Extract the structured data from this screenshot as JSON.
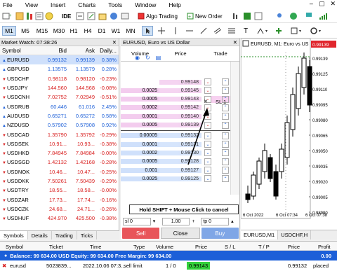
{
  "menu": [
    "File",
    "View",
    "Insert",
    "Charts",
    "Tools",
    "Window",
    "Help"
  ],
  "window_controls": [
    "–",
    "▢",
    "✕"
  ],
  "toolbar": {
    "ide_label": "IDE",
    "algo_label": "Algo Trading",
    "new_order_label": "New Order"
  },
  "timeframes": [
    "M1",
    "M5",
    "M15",
    "M30",
    "H1",
    "H4",
    "D1",
    "W1",
    "MN"
  ],
  "market_watch": {
    "title": "Market Watch: 07:38:26",
    "headers": [
      "Symbol",
      "Bid",
      "Ask",
      "Daily..."
    ],
    "rows": [
      {
        "sym": "EURUSD",
        "bid": "0.99132",
        "ask": "0.99139",
        "daily": "0.38%",
        "dir": "up",
        "selected": true
      },
      {
        "sym": "GBPUSD",
        "bid": "1.13575",
        "ask": "1.13579",
        "daily": "0.28%",
        "dir": "up"
      },
      {
        "sym": "USDCHF",
        "bid": "0.98118",
        "ask": "0.98120",
        "daily": "-0.23%",
        "dir": "dn"
      },
      {
        "sym": "USDJPY",
        "bid": "144.560",
        "ask": "144.568",
        "daily": "-0.08%",
        "dir": "dn"
      },
      {
        "sym": "USDCNH",
        "bid": "7.02752",
        "ask": "7.02949",
        "daily": "-0.51%",
        "dir": "dn"
      },
      {
        "sym": "USDRUB",
        "bid": "60.446",
        "ask": "61.016",
        "daily": "2.45%",
        "dir": "up"
      },
      {
        "sym": "AUDUSD",
        "bid": "0.65271",
        "ask": "0.65272",
        "daily": "0.58%",
        "dir": "up"
      },
      {
        "sym": "NZDUSD",
        "bid": "0.57902",
        "ask": "0.57908",
        "daily": "0.92%",
        "dir": "up"
      },
      {
        "sym": "USDCAD",
        "bid": "1.35790",
        "ask": "1.35792",
        "daily": "-0.29%",
        "dir": "dn"
      },
      {
        "sym": "USDSEK",
        "bid": "10.91...",
        "ask": "10.93...",
        "daily": "-0.38%",
        "dir": "dn"
      },
      {
        "sym": "USDHKD",
        "bid": "7.84945",
        "ask": "7.84984",
        "daily": "-0.00%",
        "dir": "dn"
      },
      {
        "sym": "USDSGD",
        "bid": "1.42132",
        "ask": "1.42168",
        "daily": "-0.28%",
        "dir": "dn"
      },
      {
        "sym": "USDNOK",
        "bid": "10.46...",
        "ask": "10.47...",
        "daily": "-0.25%",
        "dir": "dn"
      },
      {
        "sym": "USDDKK",
        "bid": "7.50261",
        "ask": "7.50439",
        "daily": "-0.29%",
        "dir": "dn"
      },
      {
        "sym": "USDTRY",
        "bid": "18.55...",
        "ask": "18.58...",
        "daily": "-0.00%",
        "dir": "dn"
      },
      {
        "sym": "USDZAR",
        "bid": "17.73...",
        "ask": "17.74...",
        "daily": "-0.16%",
        "dir": "dn"
      },
      {
        "sym": "USDCZK",
        "bid": "24.68...",
        "ask": "24.71...",
        "daily": "-0.26%",
        "dir": "dn"
      },
      {
        "sym": "USDHUF",
        "bid": "424.970",
        "ask": "425.500",
        "daily": "-0.38%",
        "dir": "dn"
      }
    ],
    "tabs": [
      "Symbols",
      "Details",
      "Trading",
      "Ticks"
    ]
  },
  "dom": {
    "title": "EURUSD, Euro vs US Dollar",
    "headers": [
      "Volume",
      "Price",
      "Trade"
    ],
    "asks": [
      {
        "vol": "",
        "price": "0.99148"
      },
      {
        "vol": "0.0025",
        "price": "0.99145"
      },
      {
        "vol": "0.0005",
        "price": "0.99143"
      },
      {
        "vol": "0.0002",
        "price": "0.99142"
      },
      {
        "vol": "0.0001",
        "price": "0.99140"
      },
      {
        "vol": "0.0005",
        "price": "0.99139"
      }
    ],
    "bids": [
      {
        "vol": "0.00005",
        "price": "0.99132"
      },
      {
        "vol": "0.0001",
        "price": "0.99131"
      },
      {
        "vol": "0.0002",
        "price": "0.99130"
      },
      {
        "vol": "0.0005",
        "price": "0.99128"
      },
      {
        "vol": "0.001",
        "price": "0.99127"
      },
      {
        "vol": "0.0025",
        "price": "0.99125"
      }
    ],
    "sl_label": "SL 1",
    "tooltip": "Hold SHIFT + Mouse Click to cancel",
    "lot_value": "1.00",
    "left_field": "sl 0",
    "right_field": "tp 0",
    "sell_label": "Sell",
    "close_label": "Close",
    "buy_label": "Buy"
  },
  "chart": {
    "title": "EURUSD, M1: Euro vs US",
    "prices": [
      "0.99139",
      "0.99125",
      "0.99110",
      "0.99095",
      "0.99080",
      "0.99065",
      "0.99050",
      "0.99035",
      "0.99020",
      "0.99005",
      "0.98990"
    ],
    "price_tag": "0.99139",
    "time_labels": [
      "6 Oct 2022",
      "6 Oct 07:34",
      "6 Oct 07:38"
    ],
    "tabs": [
      "EURUSD,M1",
      "USDCHF,H"
    ]
  },
  "trade_table": {
    "headers": [
      "Symbol",
      "Ticket",
      "Time",
      "Type",
      "Volume",
      "Price",
      "S / L",
      "T / P",
      "Price",
      "Profit"
    ],
    "balance_text": "Balance: 99 634.00 USD  Equity: 99 634.00  Free Margin: 99 634.00",
    "balance_profit": "0.00",
    "order": {
      "symbol": "eurusd",
      "ticket": "5023839...",
      "time": "2022.10.06 07:3...",
      "type": "sell limit",
      "volume": "1 / 0",
      "price": "0.99143",
      "price2": "0.99132",
      "profit": "placed"
    }
  },
  "colors": {
    "accent": "#1c5fd8",
    "sell": "#e8555a",
    "buy": "#7fa6e6",
    "ask_bg": "#f3ccee",
    "bid_bg": "#cfe0fb"
  }
}
